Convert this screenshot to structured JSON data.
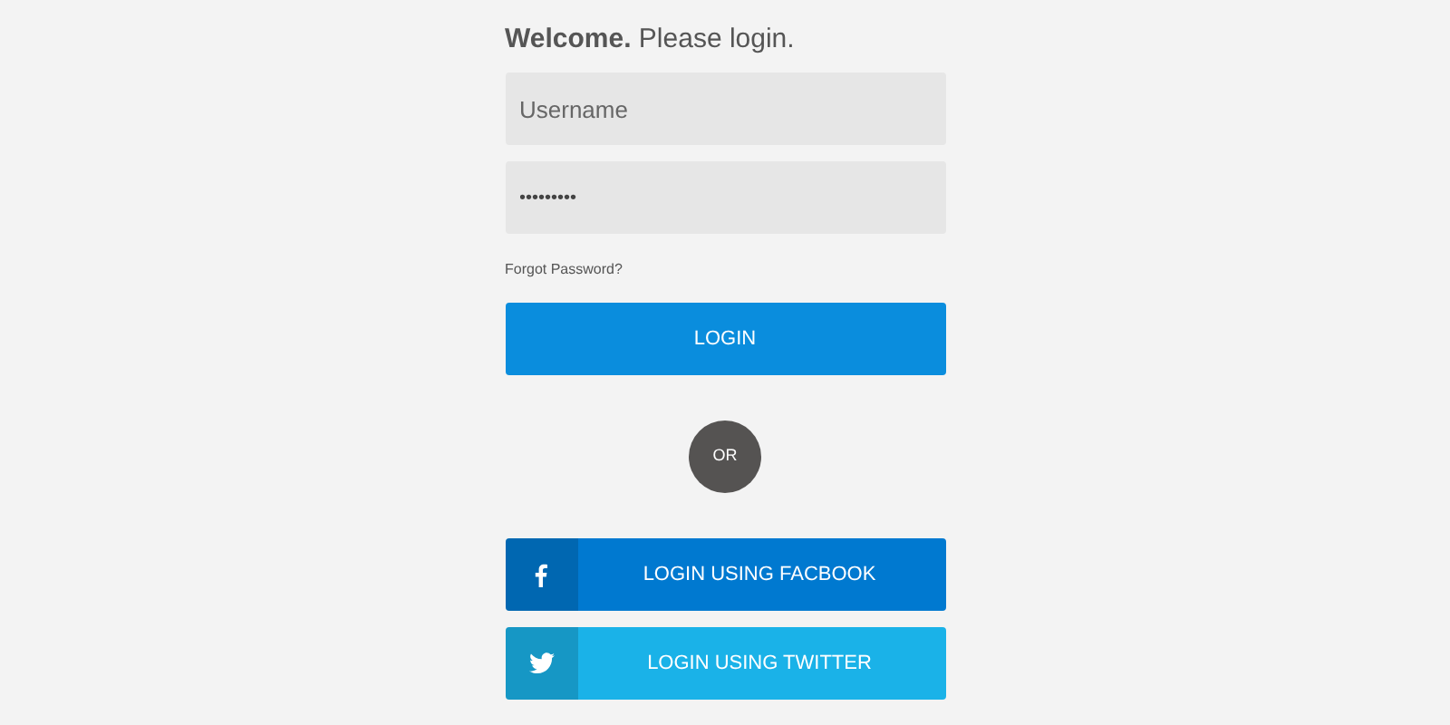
{
  "heading": "**Welcome.** Please login.",
  "username": {
    "placeholder": "Username"
  },
  "password": {
    "value": "•••••••••"
  },
  "forgot_link": "Forgot Password?",
  "login_button": "LOGIN",
  "divider": "OR",
  "social_buttons": [
    {
      "kind": "facebook",
      "label": "LOGIN USING FACBOOK",
      "color": "#0079d0"
    },
    {
      "kind": "twitter",
      "label": "LOGIN USING TWITTER",
      "color": "#1ab2e8"
    }
  ]
}
